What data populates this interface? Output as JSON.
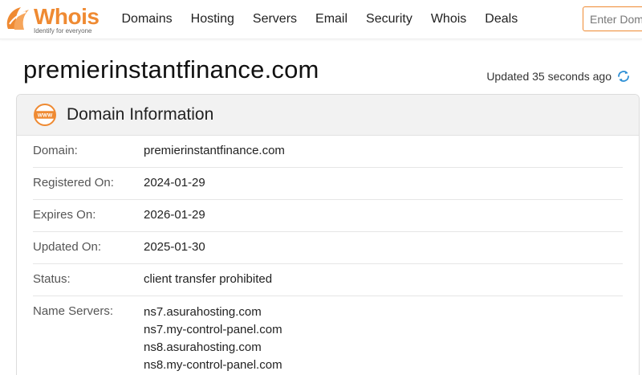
{
  "brand": {
    "name_part1": "Who",
    "name_part2": "is",
    "tagline": "Identify for everyone"
  },
  "nav": {
    "items": [
      "Domains",
      "Hosting",
      "Servers",
      "Email",
      "Security",
      "Whois",
      "Deals"
    ]
  },
  "search": {
    "placeholder": "Enter Domain",
    "value": ""
  },
  "page": {
    "title": "premierinstantfinance.com",
    "updated_text": "Updated 35 seconds ago"
  },
  "card": {
    "title": "Domain Information",
    "icon": "www-icon",
    "rows": {
      "domain": {
        "label": "Domain:",
        "value": "premierinstantfinance.com"
      },
      "registered": {
        "label": "Registered On:",
        "value": "2024-01-29"
      },
      "expires": {
        "label": "Expires On:",
        "value": "2026-01-29"
      },
      "updated": {
        "label": "Updated On:",
        "value": "2025-01-30"
      },
      "status": {
        "label": "Status:",
        "value": "client transfer prohibited"
      },
      "name_servers": {
        "label": "Name Servers:",
        "values": [
          "ns7.asurahosting.com",
          "ns7.my-control-panel.com",
          "ns8.asurahosting.com",
          "ns8.my-control-panel.com"
        ]
      }
    }
  },
  "colors": {
    "accent": "#ef8a32",
    "refresh": "#2d8fd5"
  }
}
